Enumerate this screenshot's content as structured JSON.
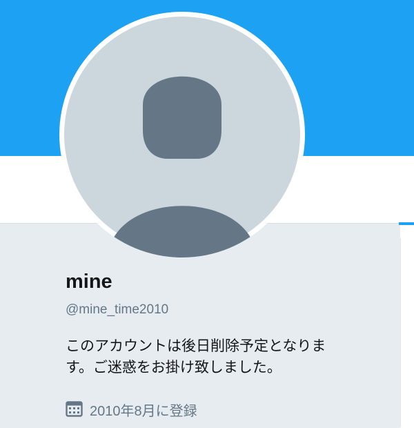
{
  "profile": {
    "display_name": "mine",
    "screen_name": "@mine_time2010",
    "bio_lines": [
      "このアカウントは後日削除予定となりま",
      "す。ご迷惑をお掛け致しました。"
    ],
    "joined": "2010年8月に登録"
  },
  "icons": {
    "avatar": "default-avatar-silhouette",
    "calendar": "calendar-icon"
  },
  "colors": {
    "banner": "#1da1f2",
    "card_background": "#e6ecf0",
    "avatar_background": "#ccd6dd",
    "avatar_silhouette": "#657786",
    "text_primary": "#14171a",
    "text_secondary": "#657786"
  }
}
